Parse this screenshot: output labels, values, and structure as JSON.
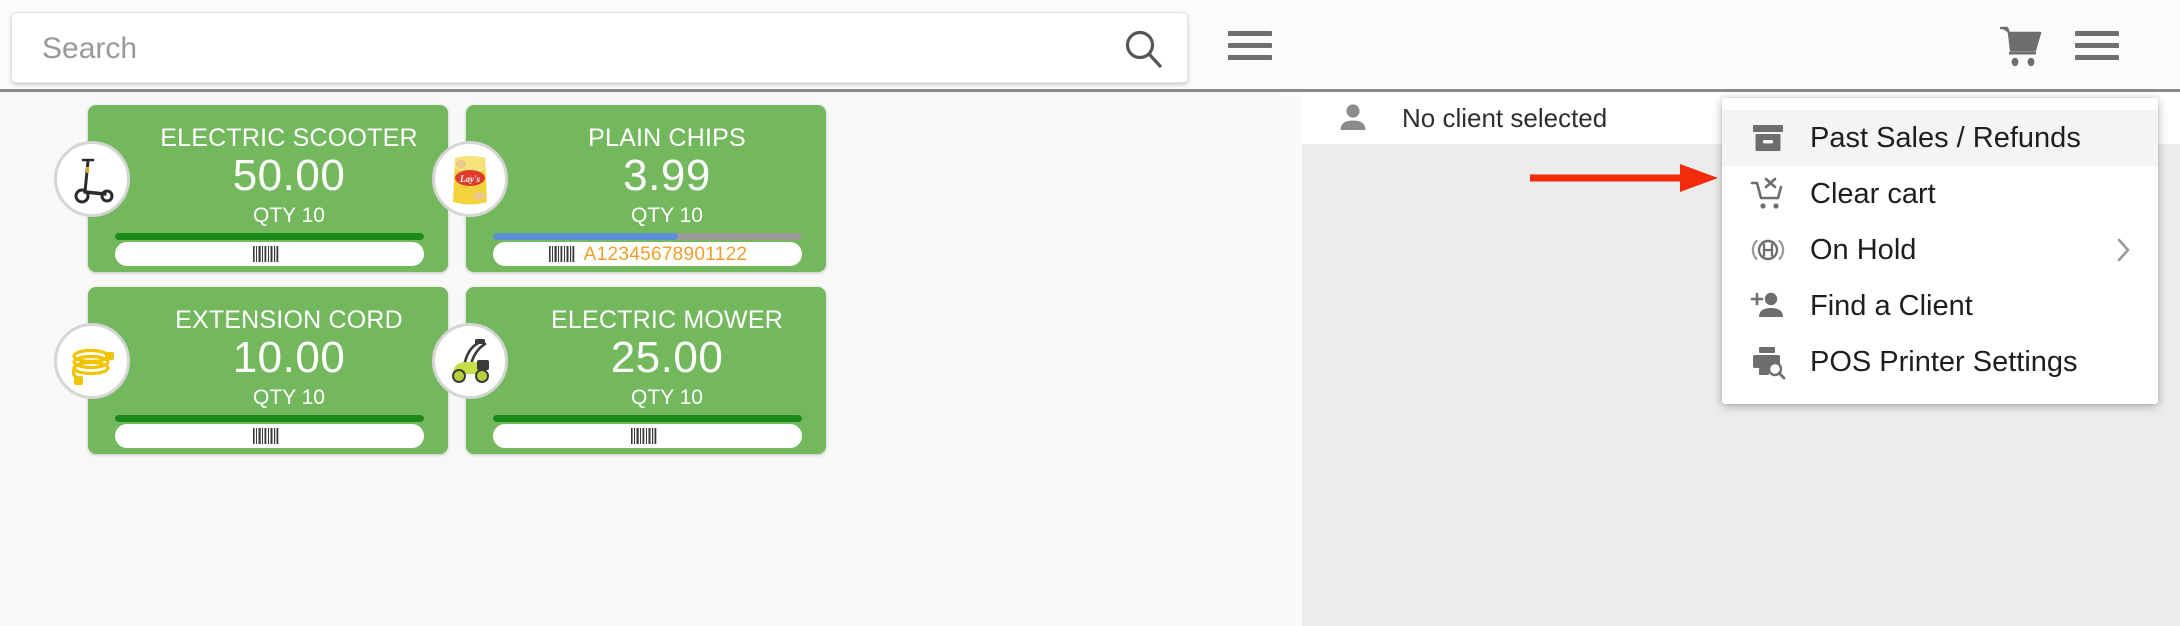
{
  "search": {
    "placeholder": "Search",
    "value": "",
    "icon": "search-icon"
  },
  "topbar": {
    "menu_icon_left": "hamburger-menu-icon",
    "cart_icon": "shopping-cart-icon",
    "menu_icon_right": "hamburger-menu-icon"
  },
  "colors": {
    "card_green": "#74b85e",
    "stock_full": "#1a8a18",
    "stock_partial": "#5b8fd8",
    "stock_empty": "#9a9a9a",
    "barcode_text": "#f0a02a",
    "arrow_red": "#f42a0c",
    "panel_gray": "#ececec",
    "highlight_gray": "#f4f4f4"
  },
  "products": [
    {
      "name": "ELECTRIC SCOOTER",
      "price": "50.00",
      "qty": "QTY 10",
      "barcode": "",
      "thumb": "electric-scooter-thumbnail",
      "stock_percent": 100,
      "stock_color": "#1a8a18"
    },
    {
      "name": "PLAIN CHIPS",
      "price": "3.99",
      "qty": "QTY 10",
      "barcode": "A12345678901122",
      "thumb": "lays-chips-thumbnail",
      "stock_percent": 60,
      "stock_color": "#5b8fd8"
    },
    {
      "name": "EXTENSION CORD",
      "price": "10.00",
      "qty": "QTY 10",
      "barcode": "",
      "thumb": "extension-cord-thumbnail",
      "stock_percent": 100,
      "stock_color": "#1a8a18"
    },
    {
      "name": "ELECTRIC MOWER",
      "price": "25.00",
      "qty": "QTY 10",
      "barcode": "",
      "thumb": "electric-mower-thumbnail",
      "stock_percent": 100,
      "stock_color": "#1a8a18"
    }
  ],
  "client": {
    "label": "No client selected",
    "icon": "person-icon"
  },
  "dropdown_menu": {
    "items": [
      {
        "label": "Past Sales / Refunds",
        "icon": "archive-box-icon",
        "highlighted": true,
        "has_submenu": false
      },
      {
        "label": "Clear cart",
        "icon": "cart-remove-icon",
        "highlighted": false,
        "has_submenu": false
      },
      {
        "label": "On Hold",
        "icon": "on-hold-icon",
        "highlighted": false,
        "has_submenu": true
      },
      {
        "label": "Find a Client",
        "icon": "person-add-icon",
        "highlighted": false,
        "has_submenu": false
      },
      {
        "label": "POS Printer Settings",
        "icon": "printer-search-icon",
        "highlighted": false,
        "has_submenu": false
      }
    ]
  },
  "annotation": {
    "arrow": "red-arrow-pointing-right",
    "target": "Past Sales / Refunds"
  }
}
